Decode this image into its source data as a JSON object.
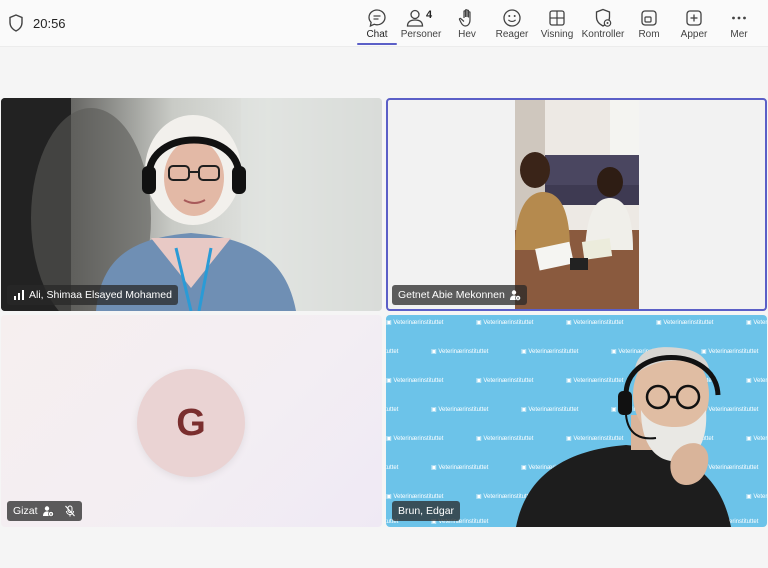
{
  "status": {
    "time": "20:56"
  },
  "toolbar": {
    "chat": "Chat",
    "people": "Personer",
    "people_count": "4",
    "raise": "Hev",
    "react": "Reager",
    "view": "Visning",
    "controls": "Kontroller",
    "rooms": "Rom",
    "apps": "Apper",
    "more": "Mer"
  },
  "participants": [
    {
      "name": "Ali, Shimaa Elsayed Mohamed"
    },
    {
      "name": "Getnet Abie Mekonnen"
    },
    {
      "name": "Gizat",
      "initial": "G"
    },
    {
      "name": "Brun, Edgar"
    }
  ],
  "backdrop": {
    "brand": "Veterinærinstituttet"
  },
  "colors": {
    "accent": "#5b5fc7",
    "brand_bg": "#6cc3e9"
  }
}
